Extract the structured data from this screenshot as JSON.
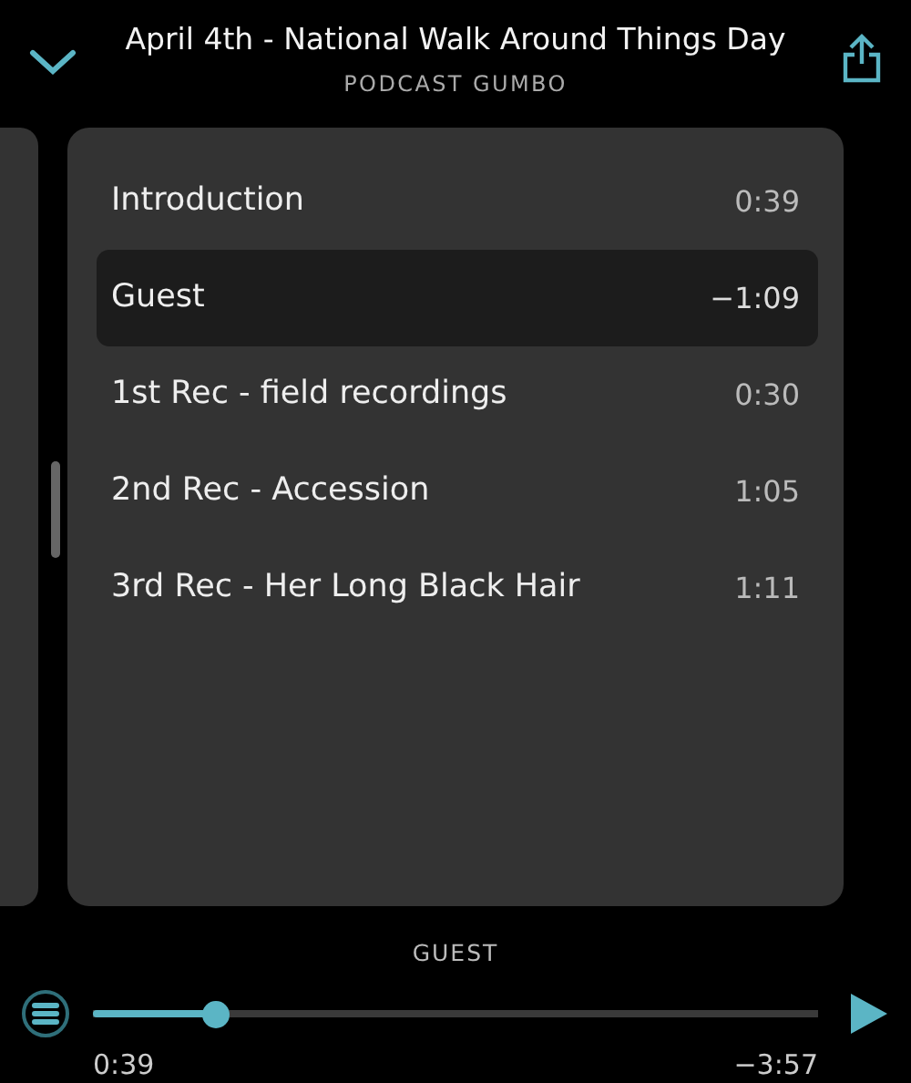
{
  "header": {
    "title": "April 4th - National Walk Around Things Day",
    "subtitle": "PODCAST GUMBO"
  },
  "chapters": [
    {
      "title": "Introduction",
      "time": "0:39",
      "selected": false
    },
    {
      "title": "Guest",
      "time": "−1:09",
      "selected": true
    },
    {
      "title": "1st Rec - field recordings",
      "time": "0:30",
      "selected": false
    },
    {
      "title": "2nd Rec - Accession",
      "time": "1:05",
      "selected": false
    },
    {
      "title": "3rd Rec - Her Long Black Hair",
      "time": "1:11",
      "selected": false
    }
  ],
  "player": {
    "chapter": "GUEST",
    "level": 0.156,
    "elapsed": "0:39",
    "remaining": "−3:57"
  }
}
